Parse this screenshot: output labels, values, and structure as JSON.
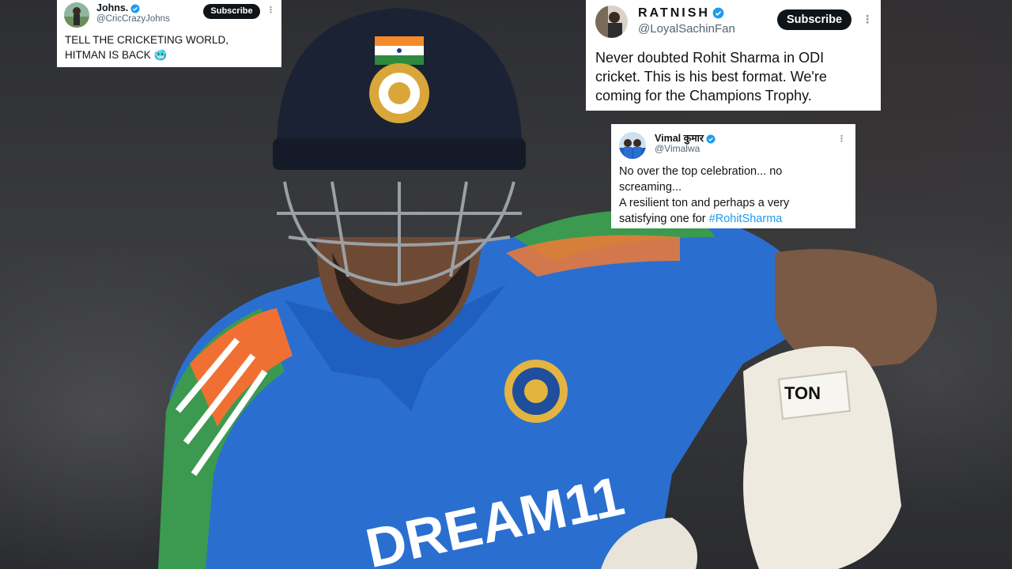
{
  "tweets": [
    {
      "name": "Johns.",
      "handle": "@CricCrazyJohns",
      "verified": true,
      "subscribe_label": "Subscribe",
      "more_icon": "more-dots-icon",
      "text_lines": [
        "TELL THE CRICKETING WORLD,",
        "HITMAN IS BACK 🥶"
      ]
    },
    {
      "name": "RATNISH",
      "handle": "@LoyalSachinFan",
      "verified": true,
      "subscribe_label": "Subscribe",
      "more_icon": "more-dots-icon",
      "text_lines": [
        "Never doubted Rohit Sharma in ODI",
        "cricket. This is his best format. We're",
        "coming for the Champions Trophy."
      ]
    },
    {
      "name": "Vimal कुमार",
      "handle": "@Vimalwa",
      "verified": true,
      "more_icon": "more-dots-icon",
      "text_lines": [
        "No over the top celebration... no",
        "screaming...",
        "A resilient ton and perhaps a very"
      ],
      "text_last_prefix": "satisfying one for ",
      "hashtag": "#RohitSharma"
    }
  ],
  "photo": {
    "jersey_sponsor": "DREAM11",
    "glove_brand": "TON"
  },
  "colors": {
    "verified_blue": "#1d9bf0",
    "jersey_blue": "#2a6fd0",
    "helmet_navy": "#1b2233",
    "subscribe_bg": "#0f1419"
  }
}
